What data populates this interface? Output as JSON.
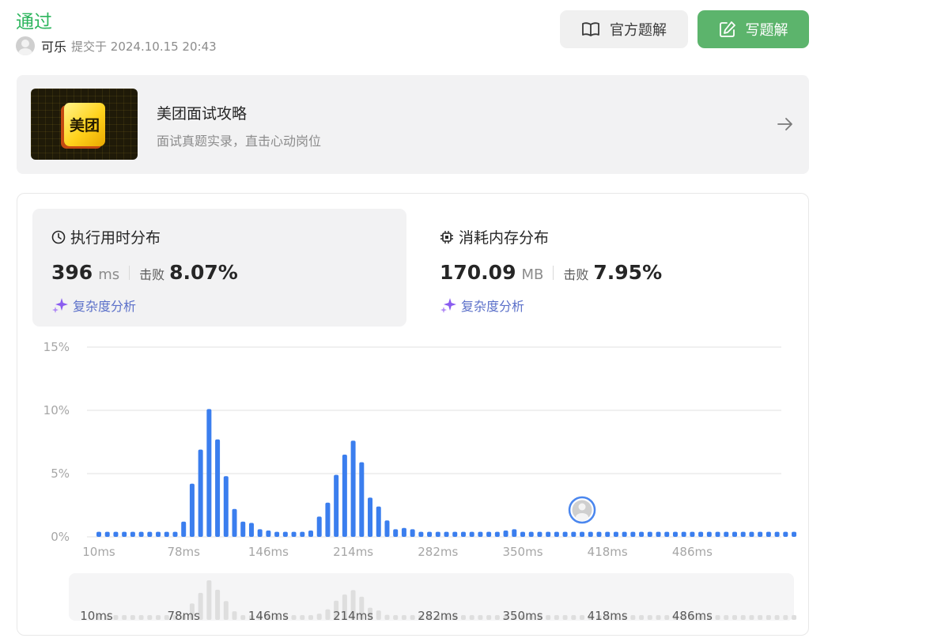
{
  "submission": {
    "status": "通过",
    "user": "可乐",
    "submitted_text": "提交于 2024.10.15 20:43",
    "status_color": "#2db55d"
  },
  "toolbar": {
    "official_solution_label": "官方题解",
    "write_solution_label": "写题解",
    "write_color": "#5cb46c"
  },
  "banner": {
    "logo_text": "美团",
    "title": "美团面试攻略",
    "subtitle": "面试真题实录，直击心动岗位"
  },
  "runtime": {
    "title": "执行用时分布",
    "value": "396",
    "unit": "ms",
    "beat_label": "击败",
    "beat_pct": "8.07%",
    "analysis_label": "复杂度分析",
    "icon": "clock-icon"
  },
  "memory": {
    "title": "消耗内存分布",
    "value": "170.09",
    "unit": "MB",
    "beat_label": "击败",
    "beat_pct": "7.95%",
    "analysis_label": "复杂度分析",
    "icon": "chip-icon"
  },
  "chart_data": {
    "type": "bar",
    "bar_color": "#3b7eee",
    "y_tick_labels": [
      "15%",
      "10%",
      "5%",
      "0%"
    ],
    "x_tick_labels": [
      "10ms",
      "78ms",
      "146ms",
      "214ms",
      "282ms",
      "350ms",
      "418ms",
      "486ms"
    ],
    "ylim": [
      0,
      15
    ],
    "values": [
      0.4,
      0.4,
      0.4,
      0.4,
      0.4,
      0.4,
      0.4,
      0.4,
      0.4,
      0.4,
      1.2,
      4.2,
      6.9,
      10.1,
      7.7,
      4.8,
      2.2,
      1.2,
      1.1,
      0.6,
      0.5,
      0.4,
      0.4,
      0.4,
      0.4,
      0.5,
      1.6,
      2.7,
      4.9,
      6.5,
      7.6,
      5.9,
      3.1,
      2.4,
      1.3,
      0.6,
      0.7,
      0.6,
      0.4,
      0.4,
      0.4,
      0.4,
      0.4,
      0.4,
      0.4,
      0.4,
      0.4,
      0.4,
      0.5,
      0.6,
      0.4,
      0.4,
      0.4,
      0.4,
      0.4,
      0.4,
      0.4,
      0.4,
      0.4,
      0.4,
      0.4,
      0.4,
      0.4,
      0.4,
      0.4,
      0.4,
      0.4,
      0.4,
      0.4,
      0.4,
      0.4,
      0.4,
      0.4,
      0.4,
      0.4,
      0.4,
      0.4,
      0.4,
      0.4,
      0.4,
      0.4,
      0.4,
      0.4
    ],
    "user_marker_index": 57,
    "grid": true
  }
}
